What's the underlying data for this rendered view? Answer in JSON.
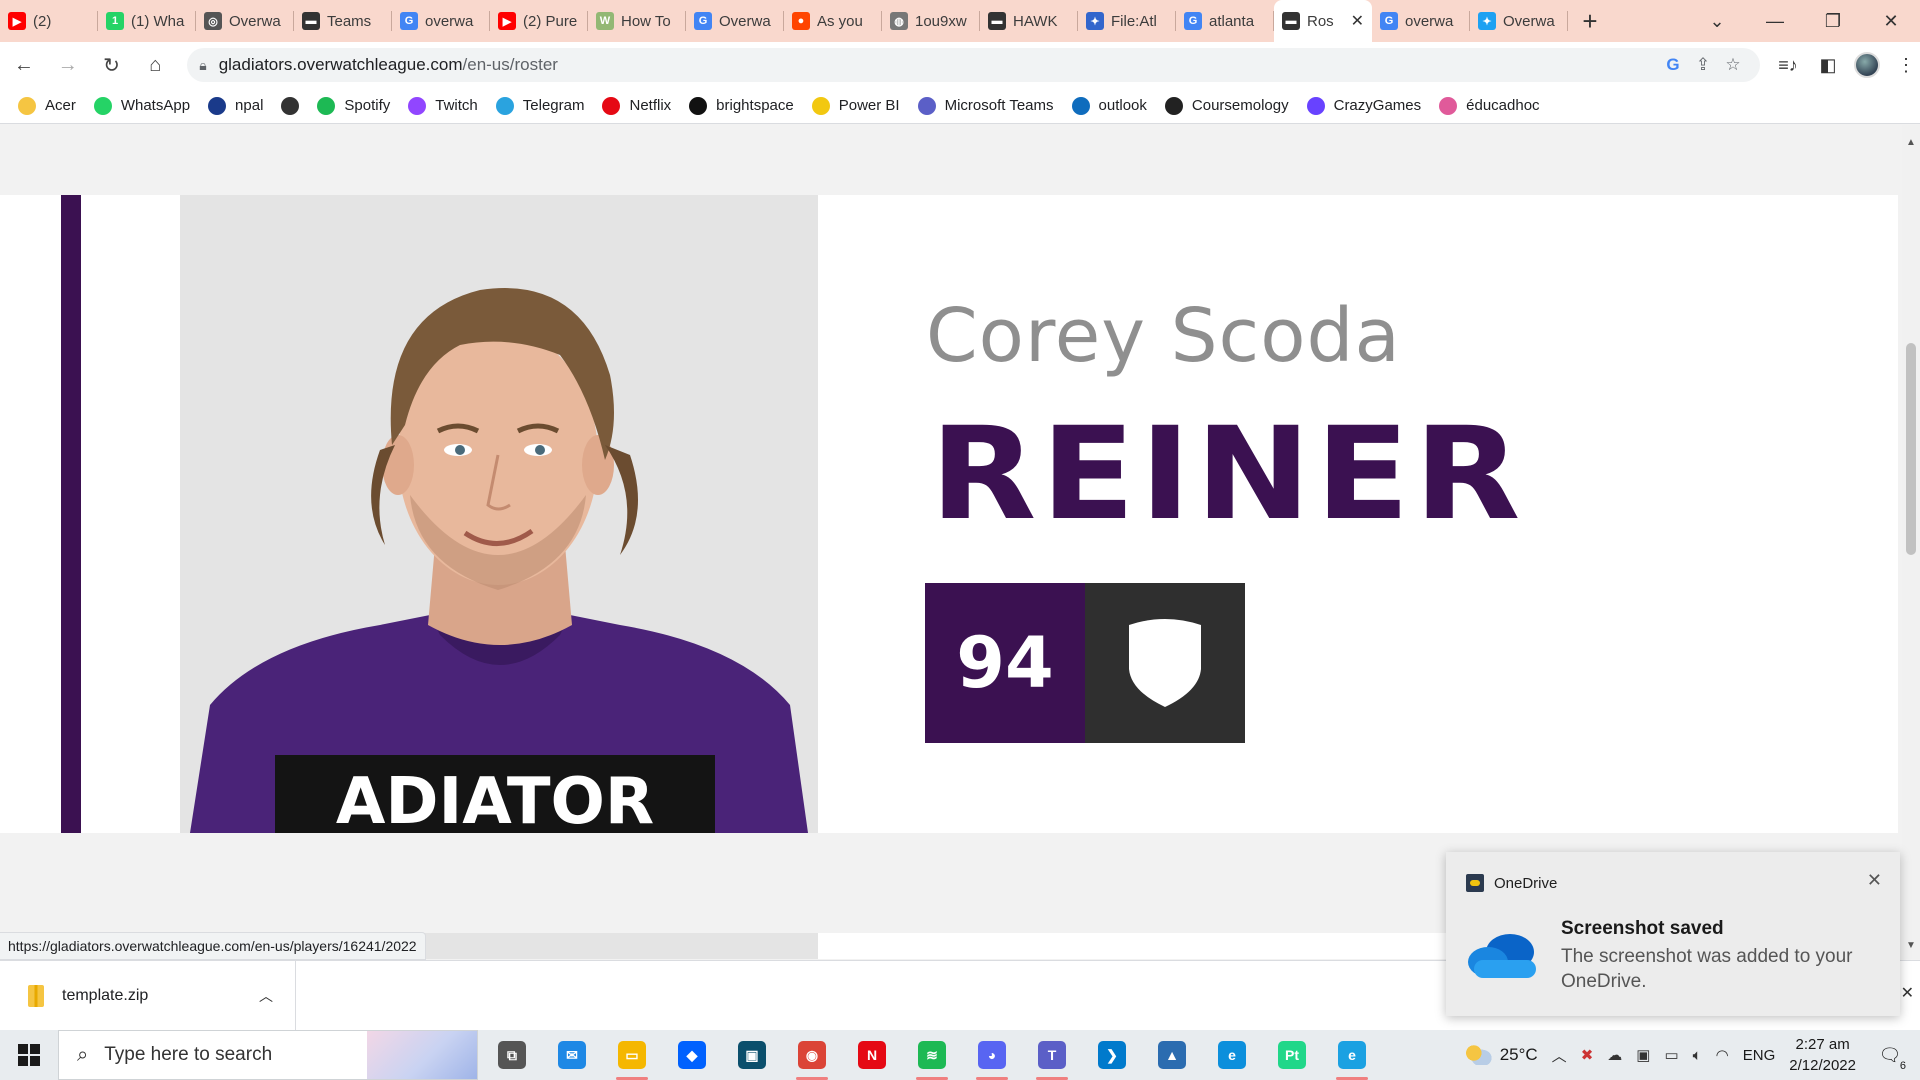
{
  "browser": {
    "tabs": [
      {
        "label": "(2)",
        "favicon": "youtube-icon",
        "color": "#ff0000",
        "glyph": "▶"
      },
      {
        "label": "(1) Wha",
        "favicon": "whatsapp-icon",
        "color": "#25d366",
        "glyph": "1"
      },
      {
        "label": "Overwa",
        "favicon": "overwatch-icon",
        "color": "#555555",
        "glyph": "◎"
      },
      {
        "label": "Teams",
        "favicon": "gladiators-icon",
        "color": "#333333",
        "glyph": "▬"
      },
      {
        "label": "overwa",
        "favicon": "google-icon",
        "color": "#4285f4",
        "glyph": "G"
      },
      {
        "label": "(2) Pure",
        "favicon": "youtube-icon",
        "color": "#ff0000",
        "glyph": "▶"
      },
      {
        "label": "How To",
        "favicon": "wikihow-icon",
        "color": "#93b874",
        "glyph": "W"
      },
      {
        "label": "Overwa",
        "favicon": "google-icon",
        "color": "#4285f4",
        "glyph": "G"
      },
      {
        "label": "As you",
        "favicon": "reddit-icon",
        "color": "#ff4500",
        "glyph": "●"
      },
      {
        "label": "1ou9xw",
        "favicon": "globe-icon",
        "color": "#777777",
        "glyph": "◍"
      },
      {
        "label": "HAWK",
        "favicon": "gladiators-icon",
        "color": "#333333",
        "glyph": "▬"
      },
      {
        "label": "File:Atl",
        "favicon": "wikimedia-icon",
        "color": "#3366cc",
        "glyph": "✦"
      },
      {
        "label": "atlanta",
        "favicon": "google-icon",
        "color": "#4285f4",
        "glyph": "G"
      },
      {
        "label": "Ros",
        "favicon": "gladiators-icon",
        "color": "#333333",
        "glyph": "▬",
        "active": true
      },
      {
        "label": "overwa",
        "favicon": "google-icon",
        "color": "#4285f4",
        "glyph": "G"
      },
      {
        "label": "Overwa",
        "favicon": "twitter-icon",
        "color": "#1da1f2",
        "glyph": "✦"
      }
    ],
    "url_host": "gladiators.overwatchleague.com",
    "url_path": "/en-us/roster",
    "bookmarks": [
      {
        "label": "Acer",
        "icon": "folder-icon",
        "color": "#f5c542"
      },
      {
        "label": "WhatsApp",
        "icon": "whatsapp-icon",
        "color": "#25d366"
      },
      {
        "label": "npal",
        "icon": "npal-icon",
        "color": "#1a3a8a"
      },
      {
        "label": "",
        "icon": "globe-icon",
        "color": "#333333"
      },
      {
        "label": "Spotify",
        "icon": "spotify-icon",
        "color": "#1db954"
      },
      {
        "label": "Twitch",
        "icon": "twitch-icon",
        "color": "#9146ff"
      },
      {
        "label": "Telegram",
        "icon": "telegram-icon",
        "color": "#2aa3df"
      },
      {
        "label": "Netflix",
        "icon": "netflix-icon",
        "color": "#e50914"
      },
      {
        "label": "brightspace",
        "icon": "np-icon",
        "color": "#111111"
      },
      {
        "label": "Power BI",
        "icon": "powerbi-icon",
        "color": "#f2c811"
      },
      {
        "label": "Microsoft Teams",
        "icon": "teams-icon",
        "color": "#5b5fc7"
      },
      {
        "label": "outlook",
        "icon": "outlook-icon",
        "color": "#0f6cbd"
      },
      {
        "label": "Coursemology",
        "icon": "coursemology-icon",
        "color": "#222222"
      },
      {
        "label": "CrazyGames",
        "icon": "crazygames-icon",
        "color": "#6842ff"
      },
      {
        "label": "éducadhoc",
        "icon": "educadhoc-icon",
        "color": "#e05a9a"
      }
    ],
    "status_url": "https://gladiators.overwatchleague.com/en-us/players/16241/2022"
  },
  "player": {
    "real_name": "Corey Scoda",
    "handle": "REINER",
    "number": "94",
    "role_icon": "shield-icon",
    "brand_color": "#3b1151",
    "jersey_text": "ADIATOR"
  },
  "download": {
    "filename": "template.zip"
  },
  "toast": {
    "app": "OneDrive",
    "title": "Screenshot saved",
    "body": "The screenshot was added to your OneDrive."
  },
  "taskbar": {
    "search_placeholder": "Type here to search",
    "temperature": "25°C",
    "language": "ENG",
    "time": "2:27 am",
    "date": "2/12/2022",
    "notification_count": "6",
    "apps": [
      {
        "name": "task-view-icon",
        "color": "#555555",
        "glyph": "⧉",
        "running": false
      },
      {
        "name": "mail-icon",
        "color": "#1e88e5",
        "glyph": "✉",
        "running": false
      },
      {
        "name": "file-explorer-icon",
        "color": "#f5b700",
        "glyph": "▭",
        "running": true
      },
      {
        "name": "dropbox-icon",
        "color": "#0061fe",
        "glyph": "◆",
        "running": false
      },
      {
        "name": "terminal-app-icon",
        "color": "#0b4f6c",
        "glyph": "▣",
        "running": false
      },
      {
        "name": "chrome-icon",
        "color": "#db4437",
        "glyph": "◉",
        "running": true
      },
      {
        "name": "netflix-icon",
        "color": "#e50914",
        "glyph": "N",
        "running": false
      },
      {
        "name": "spotify-icon",
        "color": "#1db954",
        "glyph": "≋",
        "running": true
      },
      {
        "name": "discord-icon",
        "color": "#5865f2",
        "glyph": "◕",
        "running": true
      },
      {
        "name": "teams-icon",
        "color": "#5b5fc7",
        "glyph": "T",
        "running": true
      },
      {
        "name": "vscode-icon",
        "color": "#007acc",
        "glyph": "❯",
        "running": false
      },
      {
        "name": "photos-icon",
        "color": "#2b6cb0",
        "glyph": "▲",
        "running": false
      },
      {
        "name": "edge-icon",
        "color": "#0c8fdc",
        "glyph": "e",
        "running": false
      },
      {
        "name": "pycharm-icon",
        "color": "#21d789",
        "glyph": "Pt",
        "running": false
      },
      {
        "name": "edge-dev-icon",
        "color": "#1ba1e2",
        "glyph": "e",
        "running": true
      }
    ]
  }
}
